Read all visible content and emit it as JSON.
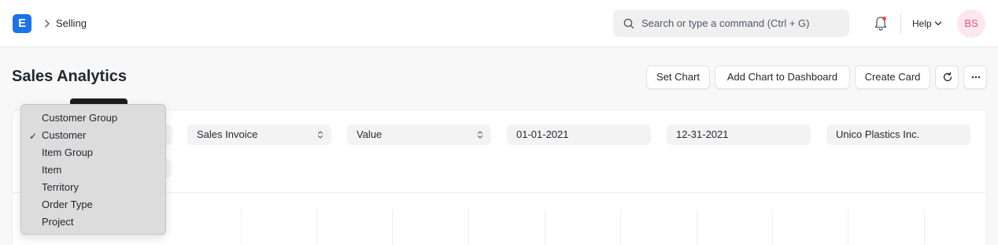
{
  "navbar": {
    "logo_letter": "E",
    "breadcrumb": "Selling",
    "search_placeholder": "Search or type a command (Ctrl + G)",
    "help_label": "Help",
    "avatar_initials": "BS"
  },
  "page": {
    "title": "Sales Analytics",
    "buttons": {
      "set_chart": "Set Chart",
      "add_chart": "Add Chart to Dashboard",
      "create_card": "Create Card"
    }
  },
  "filters": {
    "document_type": "Sales Invoice",
    "value_quantity": "Value",
    "from_date": "01-01-2021",
    "to_date": "12-31-2021",
    "company": "Unico Plastics Inc."
  },
  "dropdown": {
    "selected": "Customer",
    "options": [
      "Customer Group",
      "Customer",
      "Item Group",
      "Item",
      "Territory",
      "Order Type",
      "Project"
    ]
  },
  "colors": {
    "accent": "#1a73e8",
    "avatar_bg": "#fce7ee",
    "avatar_text": "#e0557f",
    "notification_dot": "#e24c4c"
  }
}
